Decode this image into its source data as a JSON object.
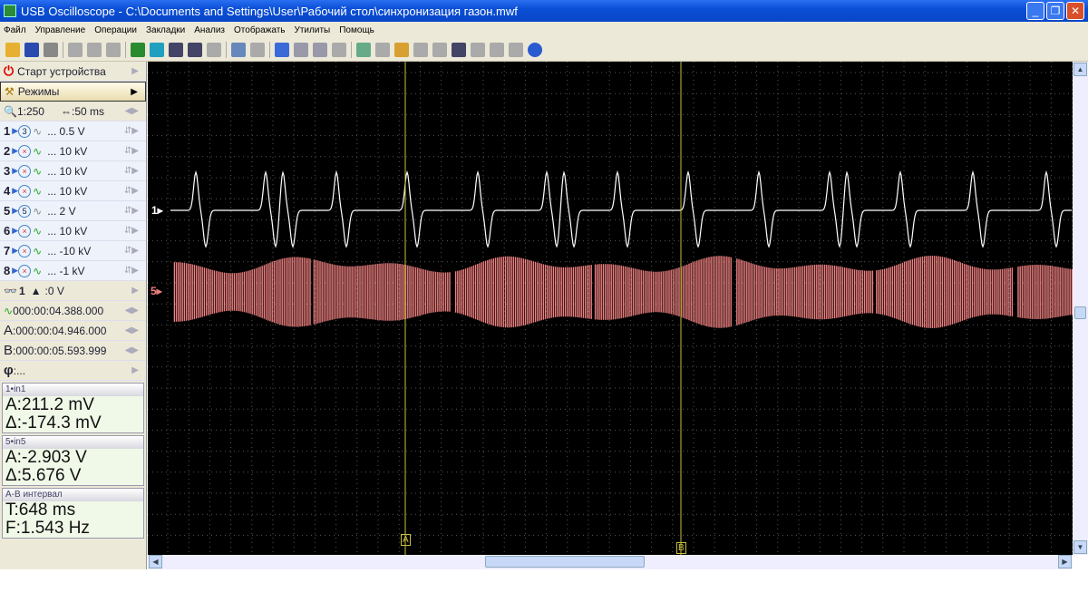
{
  "window": {
    "title": "USB Oscilloscope - C:\\Documents and Settings\\User\\Рабочий стол\\синхронизация газон.mwf"
  },
  "menu": [
    "Файл",
    "Управление",
    "Операции",
    "Закладки",
    "Анализ",
    "Отображать",
    "Утилиты",
    "Помощь"
  ],
  "toolbar": {
    "icons": [
      "open-icon",
      "save-icon",
      "print-icon",
      "copy-icon",
      "paste-icon",
      "cut-icon",
      "trigger-icon",
      "channel-icon",
      "channel-add-icon",
      "channel-remove-icon",
      "undo-icon",
      "zoom-icon",
      "marker-icon",
      "check-icon",
      "check-plus-icon",
      "check-minus-icon",
      "page-icon",
      "fit-icon",
      "pan-icon",
      "folder-icon",
      "play-icon",
      "stop-icon",
      "display-icon",
      "image-icon",
      "doc-icon",
      "delete-icon",
      "help-icon"
    ],
    "colors": [
      "#e8b030",
      "#2a4ab0",
      "#888",
      "#aaa",
      "#aaa",
      "#aaa",
      "#2a8a30",
      "#20a0c0",
      "#446",
      "#446",
      "#aaa",
      "#6688bb",
      "#aaa",
      "#3a6ad8",
      "#99a",
      "#99a",
      "#aaa",
      "#6a8",
      "#aaa",
      "#d8a030",
      "#aaa",
      "#aaa",
      "#446",
      "#aaa",
      "#aaa",
      "#aaa",
      "#2a5ad0"
    ]
  },
  "panel": {
    "start": "Старт устройства",
    "modes": "Режимы",
    "zoom": "1:250",
    "timebase": "50 ms",
    "channels": [
      {
        "num": "1",
        "state": "3",
        "range": "... 0.5 V",
        "on": true
      },
      {
        "num": "2",
        "state": "×",
        "range": "... 10 kV",
        "on": false
      },
      {
        "num": "3",
        "state": "×",
        "range": "... 10 kV",
        "on": false
      },
      {
        "num": "4",
        "state": "×",
        "range": "... 10 kV",
        "on": false
      },
      {
        "num": "5",
        "state": "5",
        "range": "... 2 V",
        "on": true
      },
      {
        "num": "6",
        "state": "×",
        "range": "... 10 kV",
        "on": false
      },
      {
        "num": "7",
        "state": "×",
        "range": "... -10 kV",
        "on": false
      },
      {
        "num": "8",
        "state": "×",
        "range": "... -1 kV",
        "on": false
      }
    ],
    "trigger": {
      "channel": "1",
      "level": ":0 V"
    },
    "trigger_time": "000:00:04.388.000",
    "cursor_a": {
      "label": "A",
      "time": ":000:00:04.946.000"
    },
    "cursor_b": {
      "label": "B",
      "time": ":000:00:05.593.999"
    },
    "phase": {
      "label": "φ",
      "value": ":..."
    }
  },
  "measurements": [
    {
      "header": "1•in1",
      "a": "A:211.2 mV",
      "d": "Δ:-174.3 mV"
    },
    {
      "header": "5•in5",
      "a": "A:-2.903 V",
      "d": "Δ:5.676 V"
    },
    {
      "header": "A-B интервал",
      "a": "T:648 ms",
      "d": "F:1.543 Hz"
    }
  ],
  "plot": {
    "ch1_label": "1▸",
    "ch5_label": "5▸",
    "ch1_color": "#ffffff",
    "ch5_color": "#f08080",
    "cursor_color": "#c8c040",
    "cursor_a": "A",
    "cursor_b": "B",
    "ch1_pulses": [
      219,
      296,
      315,
      374,
      452,
      530,
      606,
      625,
      684,
      762,
      840,
      918,
      937,
      996,
      1076,
      1157
    ]
  }
}
